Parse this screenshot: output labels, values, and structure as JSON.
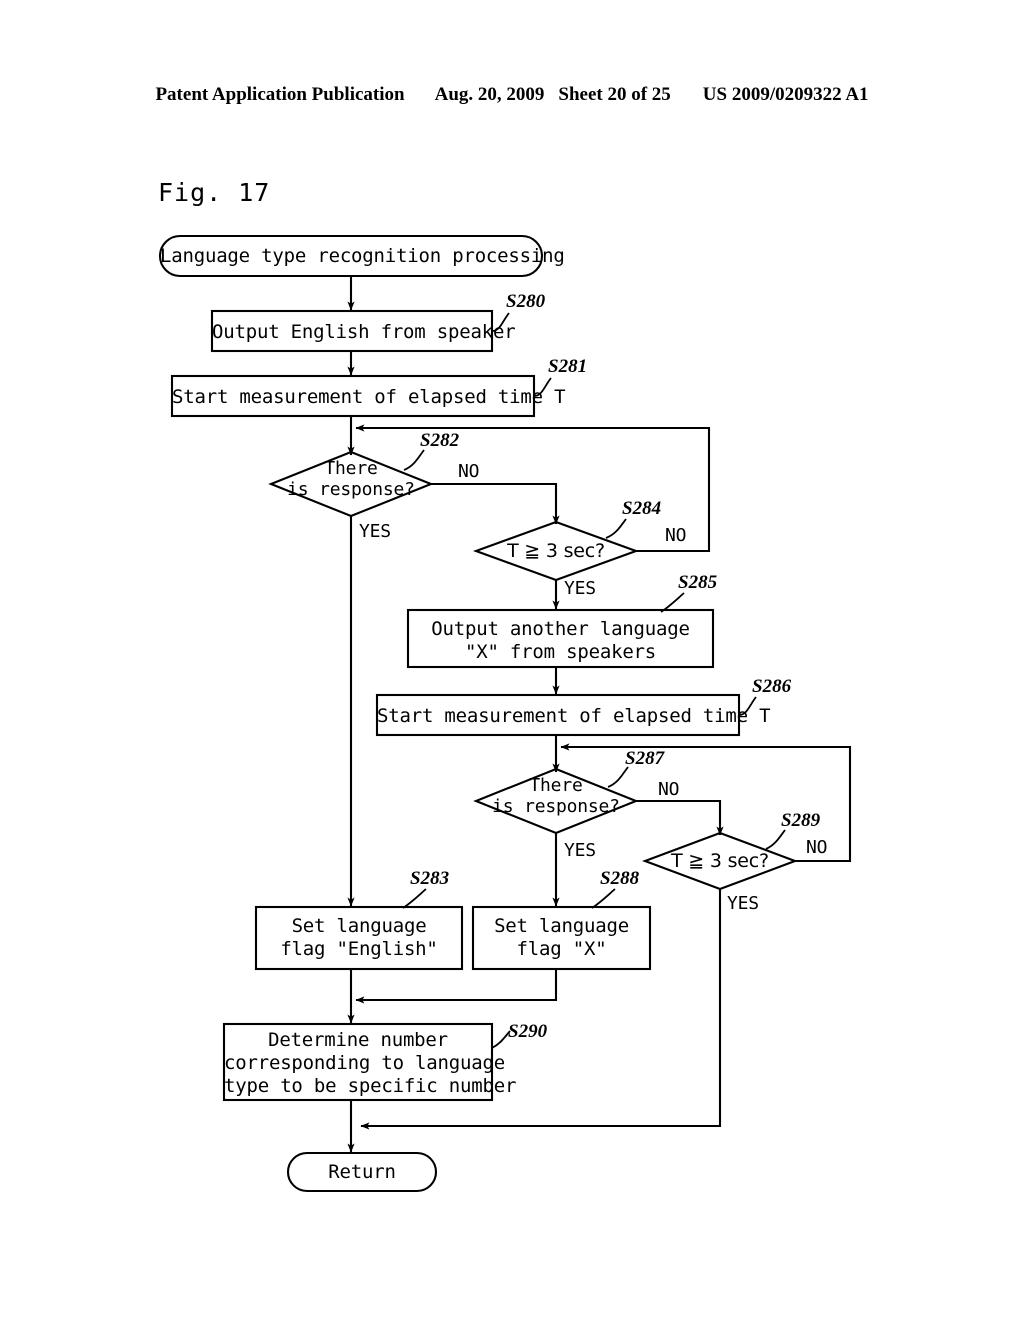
{
  "header": {
    "publication": "Patent Application Publication",
    "date": "Aug. 20, 2009",
    "sheet": "Sheet 20 of 25",
    "patent_number": "US 2009/0209322 A1"
  },
  "figure": {
    "label": "Fig. 17"
  },
  "flowchart": {
    "title": "Language type recognition processing",
    "nodes": {
      "start": {
        "text": "Language type recognition processing",
        "shape": "terminal"
      },
      "s280": {
        "text": "Output English from speaker",
        "shape": "process",
        "step": "S280"
      },
      "s281": {
        "text": "Start measurement of elapsed time T",
        "shape": "process",
        "step": "S281"
      },
      "s282": {
        "line1": "There",
        "line2": "is response?",
        "shape": "decision",
        "step": "S282"
      },
      "s284": {
        "text": "T ≧ 3 sec?",
        "shape": "decision",
        "step": "S284"
      },
      "s285": {
        "line1": "Output another language",
        "line2": "\"X\" from speakers",
        "shape": "process",
        "step": "S285"
      },
      "s286": {
        "text": "Start measurement of elapsed time T",
        "shape": "process",
        "step": "S286"
      },
      "s287": {
        "line1": "There",
        "line2": "is response?",
        "shape": "decision",
        "step": "S287"
      },
      "s289": {
        "text": "T ≧ 3 sec?",
        "shape": "decision",
        "step": "S289"
      },
      "s283": {
        "line1": "Set language",
        "line2": "flag \"English\"",
        "shape": "process",
        "step": "S283"
      },
      "s288": {
        "line1": "Set language",
        "line2": "flag \"X\"",
        "shape": "process",
        "step": "S288"
      },
      "s290": {
        "line1": "Determine number",
        "line2": "corresponding to language",
        "line3": "type to be specific number",
        "shape": "process",
        "step": "S290"
      },
      "return": {
        "text": "Return",
        "shape": "terminal"
      }
    },
    "branch_labels": {
      "s282_no": "NO",
      "s282_yes": "YES",
      "s284_no": "NO",
      "s284_yes": "YES",
      "s287_no": "NO",
      "s287_yes": "YES",
      "s289_no": "NO",
      "s289_yes": "YES"
    },
    "colors": {
      "line": "#000000",
      "background": "#ffffff"
    }
  }
}
